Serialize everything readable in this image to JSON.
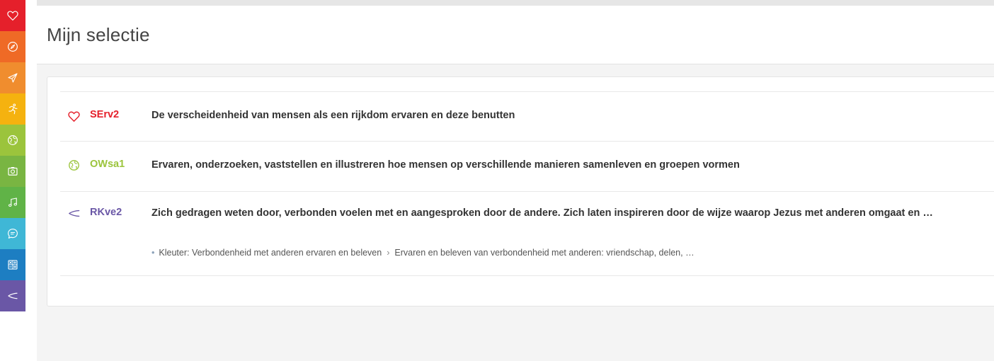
{
  "page": {
    "title": "Mijn selectie"
  },
  "sidebar": {
    "items": [
      {
        "name": "heart-icon",
        "color": "#e5202b"
      },
      {
        "name": "compass-icon",
        "color": "#ef6a26"
      },
      {
        "name": "send-icon",
        "color": "#f08d2e"
      },
      {
        "name": "running-icon",
        "color": "#f5b20f"
      },
      {
        "name": "globe-icon",
        "color": "#9bc43c"
      },
      {
        "name": "camera-icon",
        "color": "#79b542"
      },
      {
        "name": "music-icon",
        "color": "#60b347"
      },
      {
        "name": "chat-icon",
        "color": "#3fb7d6"
      },
      {
        "name": "calculator-icon",
        "color": "#1d7ec2"
      },
      {
        "name": "fish-icon",
        "color": "#6a57a6"
      }
    ]
  },
  "selection": {
    "items": [
      {
        "icon": "heart-icon",
        "color": "#e5202b",
        "code": "SErv2",
        "text": "De verscheidenheid van mensen als een rijkdom ervaren en deze benutten"
      },
      {
        "icon": "globe-icon",
        "color": "#9bc43c",
        "code": "OWsa1",
        "text": "Ervaren, onderzoeken, vaststellen en illustreren hoe mensen op verschillende manieren samenleven en groepen vormen"
      },
      {
        "icon": "fish-icon",
        "color": "#6a57a6",
        "code": "RKve2",
        "text": "Zich gedragen weten door, verbonden voelen met en aangesproken door de andere. Zich laten inspireren door de wijze waarop Jezus met anderen omgaat en …",
        "sub": {
          "bullet": "•",
          "part1": "Kleuter: Verbondenheid met anderen ervaren en beleven",
          "separator": "›",
          "part2": "Ervaren en beleven van verbondenheid met anderen: vriendschap, delen, …"
        }
      }
    ]
  }
}
